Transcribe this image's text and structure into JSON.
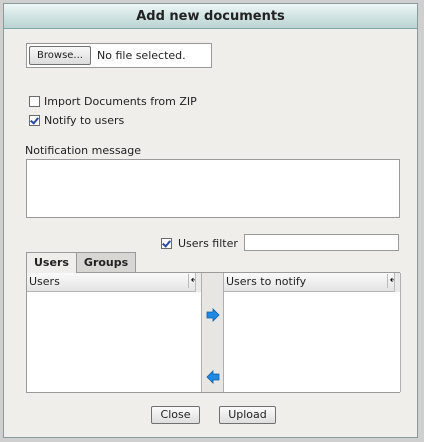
{
  "dialog": {
    "title": "Add new documents"
  },
  "file": {
    "browse_label": "Browse...",
    "status": "No file selected."
  },
  "options": {
    "import_zip": {
      "label": "Import Documents from ZIP",
      "checked": false
    },
    "notify_users": {
      "label": "Notify to users",
      "checked": true
    }
  },
  "notification": {
    "label": "Notification message",
    "value": ""
  },
  "users_filter": {
    "label": "Users filter",
    "checked": true,
    "value": ""
  },
  "tabs": [
    {
      "label": "Users",
      "active": true
    },
    {
      "label": "Groups",
      "active": false
    }
  ],
  "lists": {
    "left_header": "Users",
    "right_header": "Users to notify",
    "resize_glyph": "↔"
  },
  "transfer": {
    "add_icon": "arrow-right-icon",
    "remove_icon": "arrow-left-icon",
    "color": "#1e88e5"
  },
  "buttons": {
    "close": "Close",
    "upload": "Upload"
  }
}
